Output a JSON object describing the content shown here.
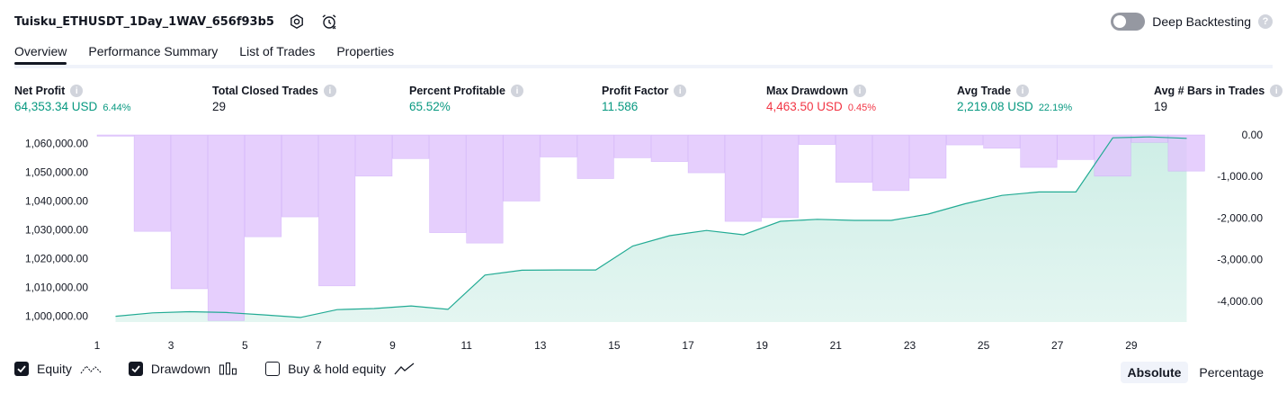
{
  "header": {
    "title": "Tuisku_ETHUSDT_1Day_1WAV_656f93b5",
    "deep_backtesting_label": "Deep Backtesting",
    "deep_backtesting_enabled": false,
    "help_glyph": "?"
  },
  "tabs": [
    {
      "label": "Overview",
      "active": true
    },
    {
      "label": "Performance Summary",
      "active": false
    },
    {
      "label": "List of Trades",
      "active": false
    },
    {
      "label": "Properties",
      "active": false
    }
  ],
  "metrics": {
    "info_glyph": "i",
    "net_profit": {
      "label": "Net Profit",
      "value": "64,353.34 USD",
      "pct": "6.44%"
    },
    "total_closed_trades": {
      "label": "Total Closed Trades",
      "value": "29"
    },
    "percent_profitable": {
      "label": "Percent Profitable",
      "value": "65.52%"
    },
    "profit_factor": {
      "label": "Profit Factor",
      "value": "11.586"
    },
    "max_drawdown": {
      "label": "Max Drawdown",
      "value": "4,463.50 USD",
      "pct": "0.45%"
    },
    "avg_trade": {
      "label": "Avg Trade",
      "value": "2,219.08 USD",
      "pct": "22.19%"
    },
    "avg_bars": {
      "label": "Avg # Bars in Trades",
      "value": "19"
    }
  },
  "chart_data": {
    "type": "area",
    "x": [
      1,
      2,
      3,
      4,
      5,
      6,
      7,
      8,
      9,
      10,
      11,
      12,
      13,
      14,
      15,
      16,
      17,
      18,
      19,
      20,
      21,
      22,
      23,
      24,
      25,
      26,
      27,
      28,
      29,
      30
    ],
    "x_tick_labels": [
      "1",
      "3",
      "5",
      "7",
      "9",
      "11",
      "13",
      "15",
      "17",
      "19",
      "21",
      "23",
      "25",
      "27",
      "29"
    ],
    "left_axis": {
      "ylim": [
        998000,
        1063000
      ],
      "tick_labels": [
        "1,060,000.00",
        "1,050,000.00",
        "1,040,000.00",
        "1,030,000.00",
        "1,020,000.00",
        "1,010,000.00",
        "1,000,000.00"
      ],
      "tick_values": [
        1060000,
        1050000,
        1040000,
        1030000,
        1020000,
        1010000,
        1000000
      ]
    },
    "right_axis": {
      "ylim": [
        -4500,
        0
      ],
      "tick_labels": [
        "0.00",
        "-1,000.00",
        "-2,000.00",
        "-3,000.00",
        "-4,000.00"
      ],
      "tick_values": [
        0,
        -1000,
        -2000,
        -3000,
        -4000
      ]
    },
    "series": [
      {
        "name": "Equity",
        "axis": "left",
        "line_color": "#22ab94",
        "fill_color": "#ceeee6",
        "values": [
          1000000,
          1001200,
          1001600,
          1001300,
          1000500,
          999600,
          1002300,
          1002700,
          1003600,
          1002400,
          1014300,
          1016000,
          1016100,
          1016100,
          1024400,
          1028000,
          1029800,
          1028300,
          1033000,
          1033700,
          1033300,
          1033300,
          1035500,
          1039100,
          1042000,
          1043200,
          1043200,
          1062000,
          1062300,
          1061800
        ]
      },
      {
        "name": "Drawdown",
        "axis": "right",
        "bar_color": "#c8a2f8",
        "bar_fill": "#e1c5fd",
        "values": [
          -30,
          -2320,
          -3700,
          -4463.5,
          -2450,
          -1970,
          -3630,
          -990,
          -570,
          -2350,
          -2600,
          -1590,
          -530,
          -1050,
          -550,
          -640,
          -910,
          -2080,
          -1990,
          -230,
          -1140,
          -1340,
          -1040,
          -240,
          -320,
          -780,
          -590,
          -990,
          -180,
          -870
        ]
      }
    ],
    "grid": false
  },
  "legend": {
    "items": [
      {
        "label": "Equity",
        "checked": true,
        "icon": "equity-line-icon"
      },
      {
        "label": "Drawdown",
        "checked": true,
        "icon": "drawdown-bars-icon"
      },
      {
        "label": "Buy & hold equity",
        "checked": false,
        "icon": "buy-hold-line-icon"
      }
    ]
  },
  "modes": [
    {
      "label": "Absolute",
      "active": true
    },
    {
      "label": "Percentage",
      "active": false
    }
  ]
}
